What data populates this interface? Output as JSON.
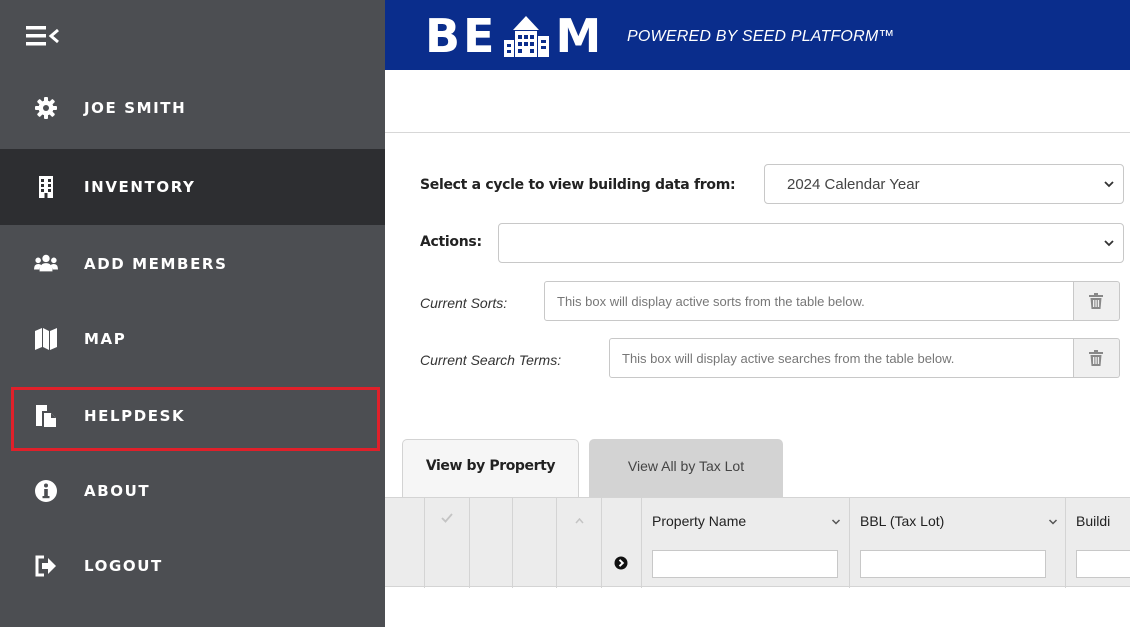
{
  "sidebar": {
    "items": [
      {
        "label": "JOE SMITH",
        "icon": "gear-icon"
      },
      {
        "label": "INVENTORY",
        "icon": "building-icon"
      },
      {
        "label": "ADD MEMBERS",
        "icon": "users-icon"
      },
      {
        "label": "MAP",
        "icon": "map-icon"
      },
      {
        "label": "HELPDESK",
        "icon": "helpdesk-icon"
      },
      {
        "label": "ABOUT",
        "icon": "info-icon"
      },
      {
        "label": "LOGOUT",
        "icon": "logout-icon"
      }
    ],
    "active_item": "INVENTORY",
    "highlighted_item": "HELPDESK"
  },
  "header": {
    "logo_left": "BE",
    "logo_right": "M",
    "tagline": "POWERED BY SEED PLATFORM™"
  },
  "filters": {
    "cycle_label": "Select a cycle to view building data from:",
    "cycle_value": "2024 Calendar Year",
    "actions_label": "Actions:",
    "actions_value": "",
    "sorts_label": "Current Sorts:",
    "sorts_placeholder": "This box will display active sorts from the table below.",
    "search_label": "Current Search Terms:",
    "search_placeholder": "This box will display active searches from the table below."
  },
  "tabs": [
    {
      "label": "View by Property",
      "active": true
    },
    {
      "label": "View All by Tax Lot",
      "active": false
    }
  ],
  "grid": {
    "columns": [
      "Property Name",
      "BBL (Tax Lot)",
      "Buildi"
    ]
  },
  "colors": {
    "sidebar_bg": "#4c4e52",
    "sidebar_active_bg": "#2d2e31",
    "header_bg": "#0a2d8c",
    "highlight": "#e0202a"
  }
}
